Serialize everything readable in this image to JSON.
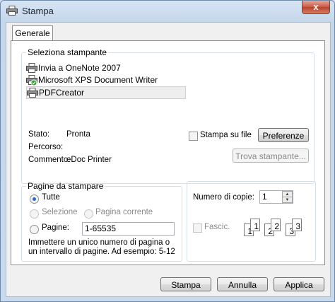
{
  "window": {
    "title": "Stampa",
    "close_glyph": "x"
  },
  "tabs": [
    {
      "label": "Generale"
    }
  ],
  "printer_group": {
    "legend": "Seleziona stampante",
    "printers": [
      {
        "name": "Invia a OneNote 2007",
        "icon": "printer-icon"
      },
      {
        "name": "Microsoft XPS Document Writer",
        "icon": "printer-default-icon"
      },
      {
        "name": "PDFCreator",
        "icon": "printer-icon",
        "selected": true
      }
    ],
    "status_label": "Stato:",
    "status_value": "Pronta",
    "path_label": "Percorso:",
    "path_value": "",
    "comment_label": "Commento:",
    "comment_value": "eDoc Printer",
    "print_to_file_label": "Stampa su file",
    "preferences_button": "Preferenze",
    "find_printer_button": "Trova stampante..."
  },
  "pages_group": {
    "legend": "Pagine da stampare",
    "all_label": "Tutte",
    "selection_label": "Selezione",
    "current_page_label": "Pagina corrente",
    "pages_label": "Pagine:",
    "pages_value": "1-65535",
    "hint": "Immettere un unico numero di pagina o un intervallo di pagine. Ad esempio: 5-12"
  },
  "copies_group": {
    "copies_label": "Numero di copie:",
    "copies_value": "1",
    "collate_label": "Fascic.",
    "collate_pages": [
      "1",
      "1",
      "2",
      "2",
      "3",
      "3"
    ]
  },
  "buttons": {
    "print": "Stampa",
    "cancel": "Annulla",
    "apply": "Applica"
  }
}
